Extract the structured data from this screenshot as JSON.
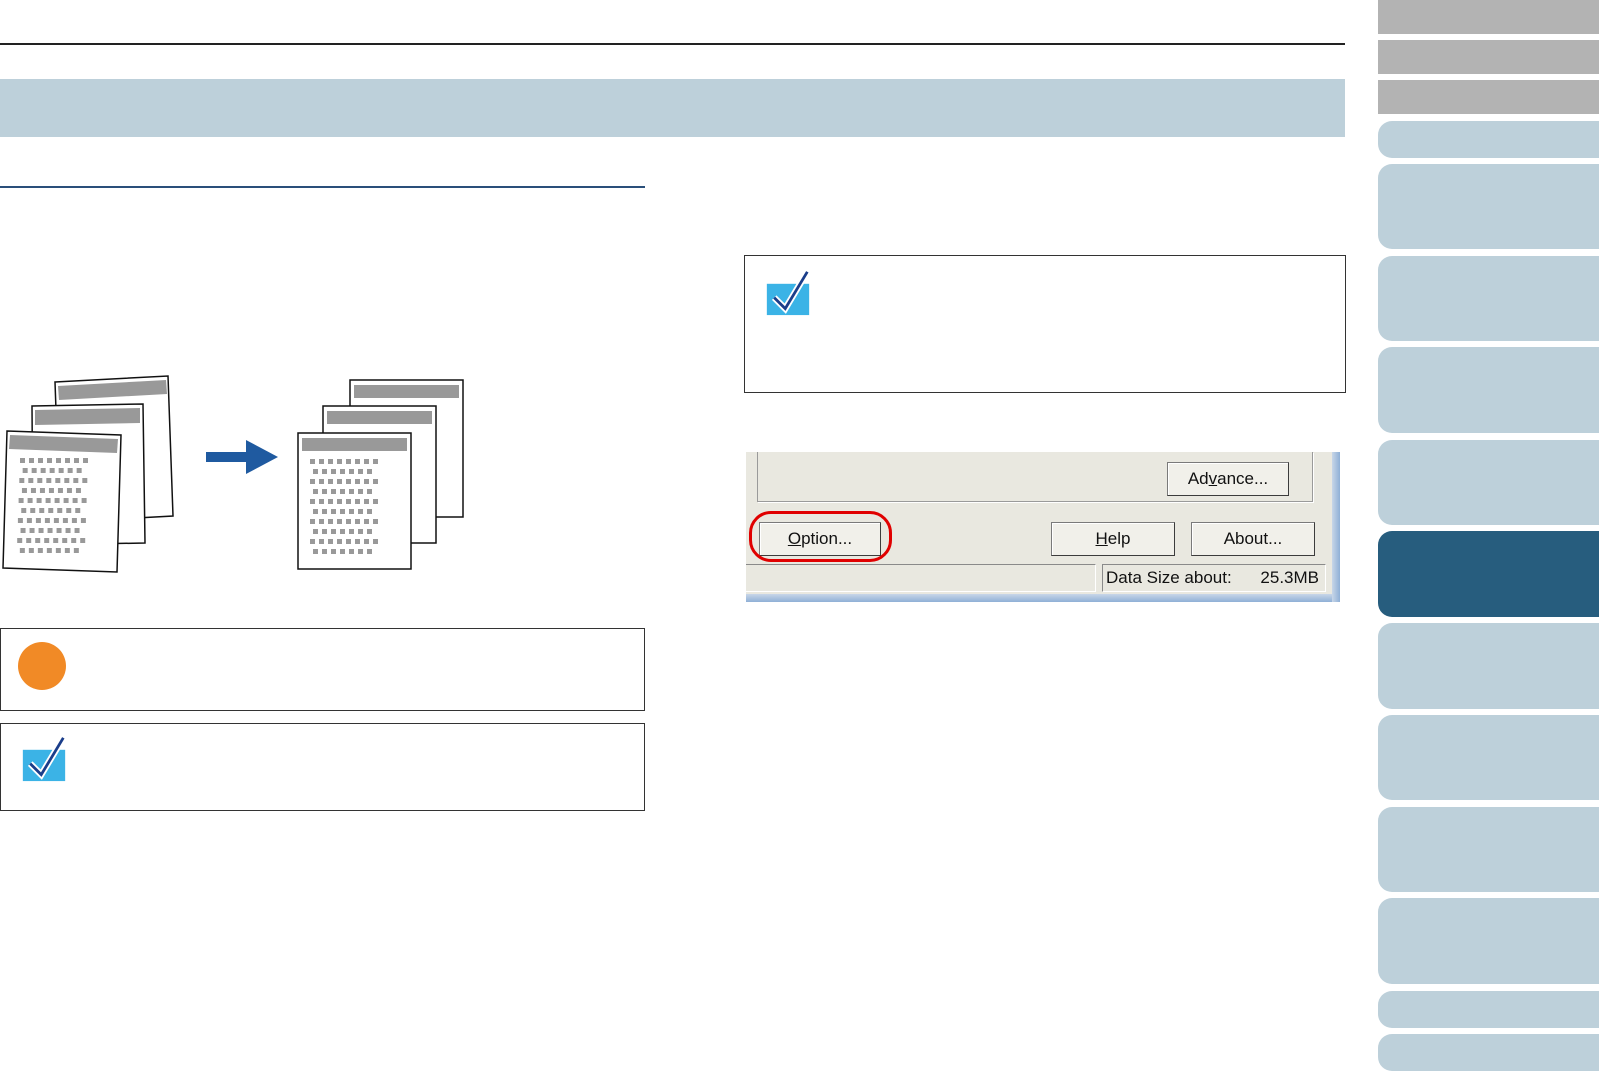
{
  "dialog": {
    "advance_label": "Advance...",
    "option_label": "Option...",
    "help_label": "Help",
    "about_label": "About...",
    "data_size_label": "Data Size about:",
    "data_size_value": "25.3MB"
  },
  "colors": {
    "title_band": "#bdd0da",
    "nav_active": "#275d7e",
    "nav_inactive": "#bdd0da",
    "nav_top": "#b3b3b3",
    "arrow": "#1f5aa0",
    "caution": "#f18a26",
    "check": "#3bb3e6",
    "highlight": "#e00000"
  },
  "icons": [
    "check-icon",
    "caution-icon",
    "arrow-right-icon"
  ]
}
